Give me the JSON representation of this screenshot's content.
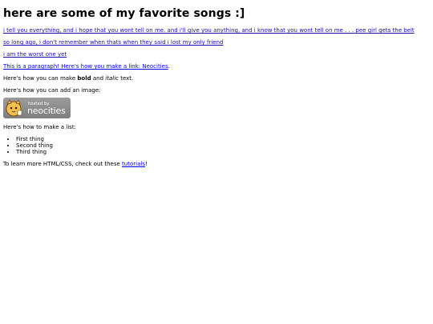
{
  "page": {
    "title": "here are some of my favorite songs :]"
  },
  "songs": [
    {
      "label": "i tell you everything, and i hope that you wont tell on me. and i'll give you anything, and i know that you wont tell on me . . . pee girl gets the belt"
    },
    {
      "label": "so long ago, i don't remember when thats when they said i lost my only friend"
    },
    {
      "label": "i am the worst one yet"
    }
  ],
  "paragraph_link": "This is a paragraph! Here's how you make a link: Neocities",
  "paragraph_link_suffix": ".",
  "format_text": {
    "prefix": "Here's how you can make ",
    "bold": "bold",
    "middle": " and ",
    "italic": "italic",
    "suffix": " text."
  },
  "image_text": "Here's how you can add an image:",
  "badge": {
    "hosted": "hosted by",
    "name": "neocities",
    "icon": "neocities-cat-icon"
  },
  "list_heading": "Here's how to make a list:",
  "list_items": [
    "First thing",
    "Second thing",
    "Third thing"
  ],
  "learn_more": {
    "prefix": "To learn more HTML/CSS, check out these ",
    "link": "tutorials",
    "suffix": "!"
  },
  "colors": {
    "link": "#0000ee",
    "text": "#000000",
    "badge_bg": "#8a8a8a"
  }
}
